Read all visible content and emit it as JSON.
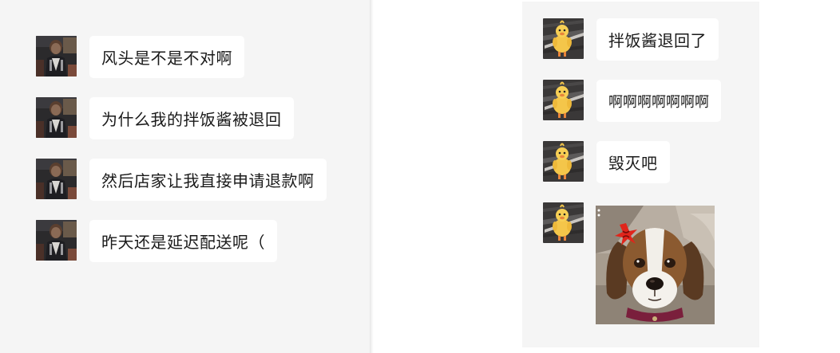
{
  "left_chat": {
    "messages": [
      {
        "text": "风头是不是不对啊",
        "avatar_icon": "person-photo-avatar"
      },
      {
        "text": "为什么我的拌饭酱被退回",
        "avatar_icon": "person-photo-avatar"
      },
      {
        "text": "然后店家让我直接申请退款啊",
        "avatar_icon": "person-photo-avatar"
      },
      {
        "text": "昨天还是延迟配送呢（",
        "avatar_icon": "person-photo-avatar"
      }
    ]
  },
  "right_chat": {
    "messages": [
      {
        "text": "拌饭酱退回了",
        "avatar_icon": "duck-avatar"
      },
      {
        "text": "啊啊啊啊啊啊啊",
        "avatar_icon": "duck-avatar"
      },
      {
        "text": "毁灭吧",
        "avatar_icon": "duck-avatar"
      }
    ],
    "sticker": {
      "kind": "image",
      "subject": "angry-beagle-sticker",
      "avatar_icon": "duck-avatar"
    }
  },
  "colors": {
    "left_background": "#f5f5f5",
    "right_background": "#f5f5f5",
    "page_background": "#ffffff",
    "bubble": "#ffffff",
    "text": "#1a1a1a",
    "anger_mark": "#e0251b"
  }
}
